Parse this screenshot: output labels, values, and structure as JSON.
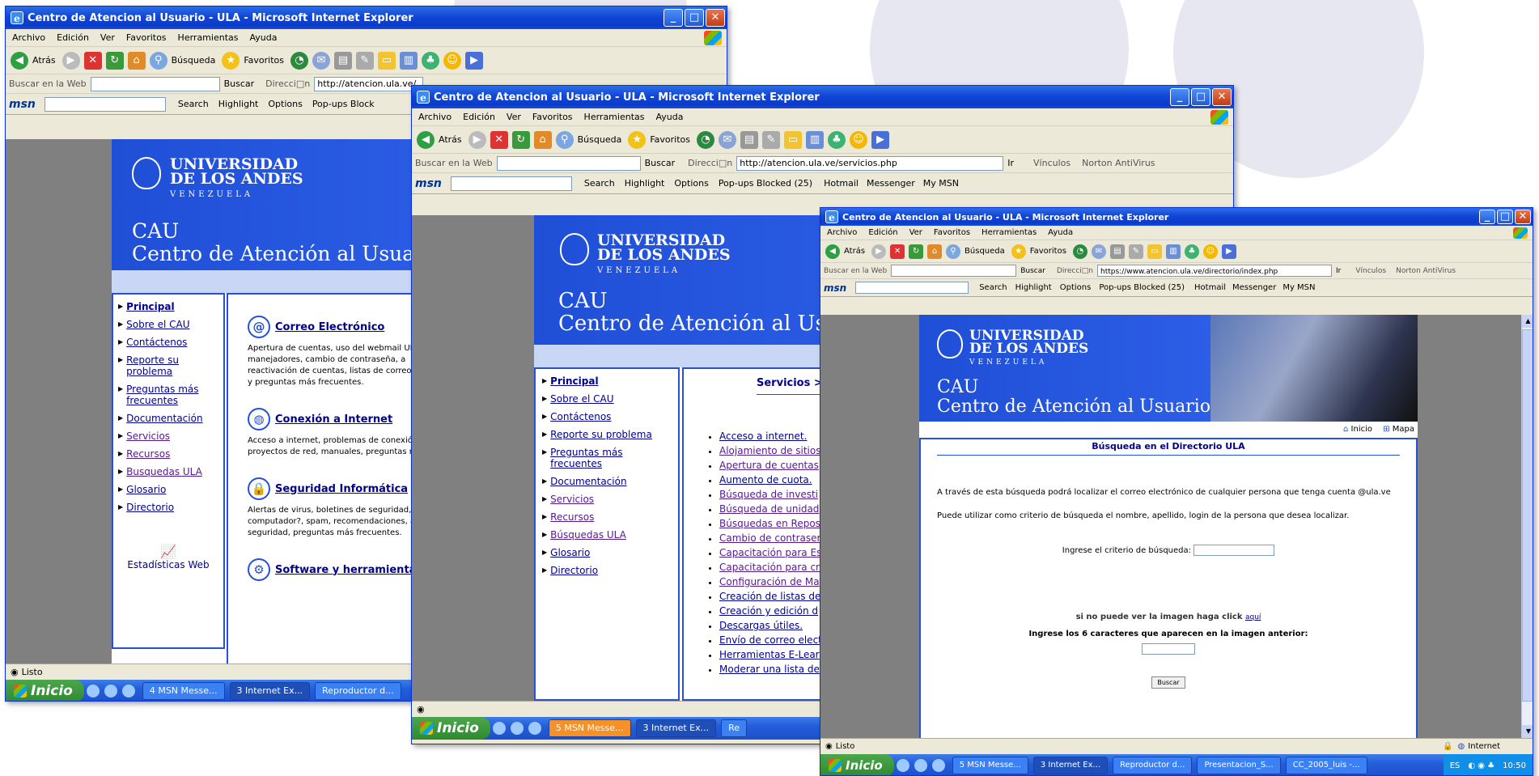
{
  "windows": [
    {
      "title": "Centro de Atencion al Usuario - ULA - Microsoft Internet Explorer",
      "menu": [
        "Archivo",
        "Edición",
        "Ver",
        "Favoritos",
        "Herramientas",
        "Ayuda"
      ],
      "toolbar": {
        "back": "Atrás",
        "search": "Búsqueda",
        "favorites": "Favoritos"
      },
      "search_web_label": "Buscar en la Web",
      "search_button": "Buscar",
      "address_label": "Direcci□n",
      "address": "http://atencion.ula.ve/",
      "msn": {
        "search": "Search",
        "highlight": "Highlight",
        "options": "Options",
        "popups": "Pop-ups Block"
      },
      "status": "Listo",
      "taskbar": {
        "start": "Inicio",
        "tasks": [
          "4 MSN Messe...",
          "3 Internet Ex...",
          "Reproductor d..."
        ]
      },
      "nav": [
        "Principal",
        "Sobre el CAU",
        "Contáctenos",
        "Reporte su problema",
        "Preguntas más frecuentes",
        "Documentación",
        "Servicios",
        "Recursos",
        "Busquedas ULA",
        "Glosario",
        "Directorio"
      ],
      "stats": "Estadísticas Web",
      "services": [
        {
          "icon": "@",
          "title": "Correo Electrónico",
          "desc": [
            "Apertura de cuentas, uso del webmail ULA,",
            "manejadores, cambio de contraseña, a",
            "reactivación de cuentas, listas de correo el",
            "y preguntas más frecuentes."
          ]
        },
        {
          "icon": "◍",
          "title": "Conexión a Internet",
          "desc": [
            "Acceso a internet, problemas de conexión, n",
            "proyectos de red, manuales, preguntas más"
          ]
        },
        {
          "icon": "🔒",
          "title": "Seguridad Informática",
          "desc": [
            "Alertas de virus, boletines de seguridad, ¿Có",
            "computador?, spam, recomendaciones, antiv",
            "seguridad, preguntas más frecuentes."
          ]
        },
        {
          "icon": "⚙",
          "title": "Software y herramientas w",
          "desc": []
        }
      ]
    },
    {
      "title": "Centro de Atencion al Usuario - ULA - Microsoft Internet Explorer",
      "menu": [
        "Archivo",
        "Edición",
        "Ver",
        "Favoritos",
        "Herramientas",
        "Ayuda"
      ],
      "toolbar": {
        "back": "Atrás",
        "search": "Búsqueda",
        "favorites": "Favoritos"
      },
      "search_web_label": "Buscar en la Web",
      "search_button": "Buscar",
      "address_label": "Direcci□n",
      "address": "http://atencion.ula.ve/servicios.php",
      "go": "Ir",
      "links": "Vínculos",
      "norton": "Norton AntiVirus",
      "msn": {
        "search": "Search",
        "highlight": "Highlight",
        "options": "Options",
        "popups": "Pop-ups Blocked (25)",
        "hotmail": "Hotmail",
        "messenger": "Messenger",
        "mymsn": "My MSN"
      },
      "taskbar": {
        "start": "Inicio",
        "tasks": [
          "5 MSN Messe...",
          "3 Internet Ex...",
          "Re"
        ]
      },
      "nav": [
        "Principal",
        "Sobre el CAU",
        "Contáctenos",
        "Reporte su problema",
        "Preguntas más frecuentes",
        "Documentación",
        "Servicios",
        "Recursos",
        "Búsquedas ULA",
        "Glosario",
        "Directorio"
      ],
      "services_header": "Servicios >>",
      "services_list": [
        "Acceso a internet.",
        "Alojamiento de sitios",
        "Apertura de cuentas",
        "Aumento de cuota.",
        "Búsqueda de investi",
        "Búsqueda de unidad",
        "Búsquedas en Repos",
        "Cambio de contraser",
        "Capacitación para Es",
        "Capacitación para cr",
        "Configuración de Ma",
        "Creación de listas de",
        "Creación y edición d",
        "Descargas útiles.",
        "Envío de correo elect",
        "Herramientas E-Lear",
        "Moderar una lista de"
      ]
    },
    {
      "title": "Centro de Atencion al Usuario - ULA - Microsoft Internet Explorer",
      "menu": [
        "Archivo",
        "Edición",
        "Ver",
        "Favoritos",
        "Herramientas",
        "Ayuda"
      ],
      "toolbar": {
        "back": "Atrás",
        "search": "Búsqueda",
        "favorites": "Favoritos"
      },
      "search_web_label": "Buscar en la Web",
      "search_button": "Buscar",
      "address_label": "Direcci□n",
      "address": "https://www.atencion.ula.ve/directorio/index.php",
      "go": "Ir",
      "links": "Vínculos",
      "norton": "Norton AntiVirus",
      "msn": {
        "search": "Search",
        "highlight": "Highlight",
        "options": "Options",
        "popups": "Pop-ups Blocked (25)",
        "hotmail": "Hotmail",
        "messenger": "Messenger",
        "mymsn": "My MSN"
      },
      "banner_links": {
        "home": "Inicio",
        "map": "Mapa"
      },
      "directory": {
        "title": "Búsqueda en el Directorio ULA",
        "p1": "A través de esta búsqueda podrá localizar el correo electrónico de cualquier persona que tenga cuenta @ula.ve",
        "p2": "Puede utilizar como criterio de búsqueda el nombre, apellido, login de la persona que desea localizar.",
        "criteria_label": "Ingrese el criterio de búsqueda:",
        "image_note": "si no puede ver la imagen haga click",
        "image_link": "aquí",
        "captcha_label": "Ingrese los 6 caracteres que aparecen en la imagen anterior:",
        "submit": "Buscar"
      },
      "status": "Listo",
      "zone": "Internet",
      "taskbar": {
        "start": "Inicio",
        "tasks": [
          "5 MSN Messe...",
          "3 Internet Ex...",
          "Reproductor d...",
          "Presentacion_S...",
          "CC_2005_luis -..."
        ],
        "lang": "ES",
        "clock": "10:50"
      }
    }
  ],
  "brand": {
    "uni_line1": "UNIVERSIDAD",
    "uni_line2": "DE LOS ANDES",
    "country": "VENEZUELA",
    "cau": "CAU",
    "cau_full": "Centro de Atención al Usuario"
  },
  "colors": {
    "xp_blue": "#0a3bc9",
    "banner_blue": "#2650d6",
    "link": "#00008b",
    "visited": "#551a8b"
  }
}
